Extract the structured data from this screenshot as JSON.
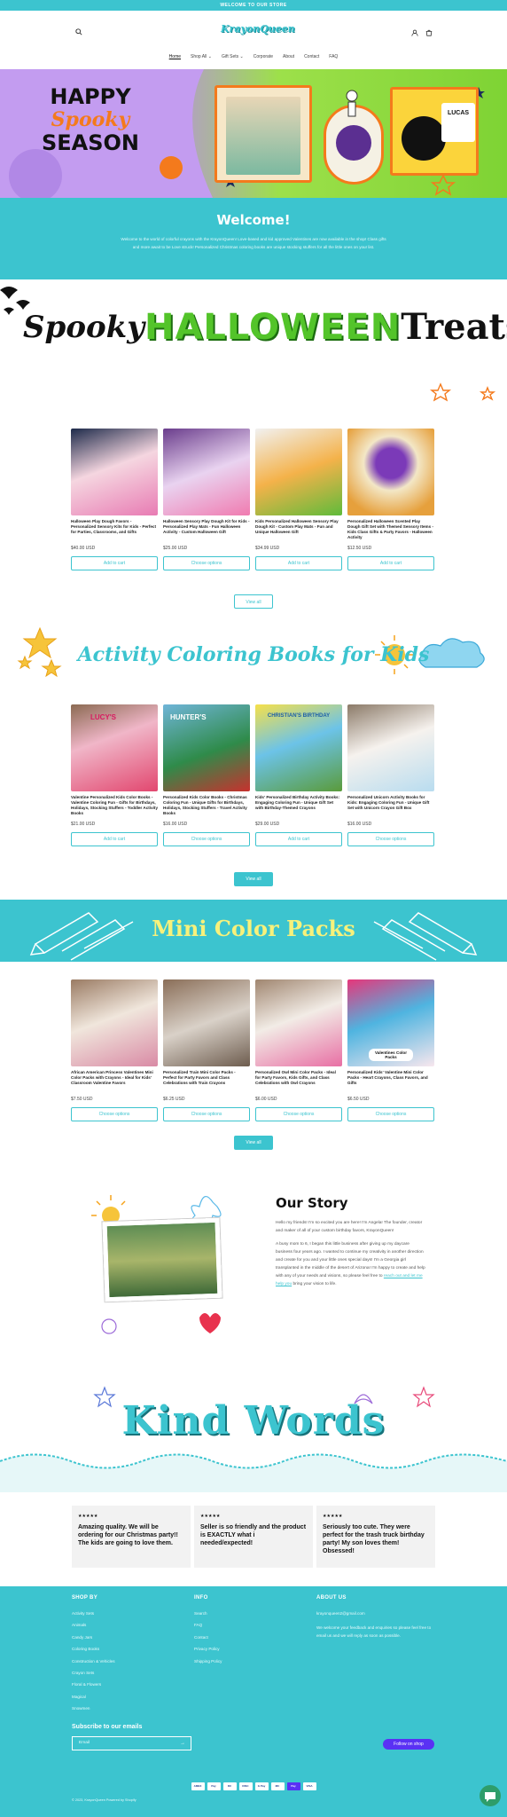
{
  "announcement": "WELCOME TO OUR STORE",
  "header": {
    "logo": "KrayonQueen",
    "nav": [
      "Home",
      "Shop All",
      "Gift Sets",
      "Corporate",
      "About",
      "Contact",
      "FAQ"
    ]
  },
  "hero": {
    "line1": "HAPPY",
    "line2": "Spooky",
    "line3": "SEASON",
    "card_label": "LUCAS"
  },
  "welcome": {
    "title": "Welcome!",
    "text": "Welcome to the world of colorful crayons with the KrayonQueen! Love-based and kid approved Valentines are now available in the shop! Class gifts and more await to be Love struck! Personalized Christmas coloring books are unique stocking stuffers for all the little ones on your list."
  },
  "spooky_banner": {
    "word1": "Spooky",
    "word2": "HALLOWEEN",
    "word3": "Treats"
  },
  "halloween_products": [
    {
      "title": "Halloween Play Dough Favors - Personalized Sensory Kits for Kids - Perfect for Parties, Classrooms, and Gifts",
      "price": "$40.00 USD",
      "button": "Add to cart"
    },
    {
      "title": "Halloween Sensory Play Dough Kit for Kids - Personalized Play Mats - Fun Halloween Activity - Custom Halloween Gift",
      "price": "$25.00 USD",
      "button": "Choose options"
    },
    {
      "title": "Kids Personalized Halloween Sensory Play Dough Kit - Custom Play Mats - Fun and Unique Halloween Gift",
      "price": "$34.99 USD",
      "button": "Add to cart"
    },
    {
      "title": "Personalized Halloween Scented Play Dough Gift Set with Themed Sensory Items - Kids Class Gifts & Party Favors - Halloween Activity",
      "price": "$12.50 USD",
      "button": "Add to cart"
    }
  ],
  "view_all": "View all",
  "activity_banner": "Activity Coloring Books for Kids",
  "activity_products": [
    {
      "title": "Valentine Personalized Kids Color Books - Valentine Coloring Fun - Gifts for Birthdays, Holidays, Stocking Stuffers - Toddler Activity Books",
      "price": "$21.00 USD",
      "button": "Add to cart",
      "cover": "LUCY'S"
    },
    {
      "title": "Personalized Kids Color Books - Christmas Coloring Fun - Unique Gifts for Birthdays, Holidays, Stocking Stuffers - Travel Activity Books",
      "price": "$16.00 USD",
      "button": "Choose options",
      "cover": "HUNTER'S"
    },
    {
      "title": "Kids' Personalized Birthday Activity Books: Engaging Coloring Fun - Unique Gift Set with Birthday-Themed Crayons",
      "price": "$29.00 USD",
      "button": "Add to cart",
      "cover": "CHRISTIAN'S BIRTHDAY"
    },
    {
      "title": "Personalized Unicorn Activity Books for Kids: Engaging Coloring Fun - Unique Gift Set with Unicorn Crayon Gift Box",
      "price": "$16.00 USD",
      "button": "Choose options",
      "cover": ""
    }
  ],
  "mini_banner": "Mini Color Packs",
  "mini_products": [
    {
      "title": "African American Princess Valentines Mini Color Packs with Crayons - Ideal for Kids' Classroom Valentine Favors",
      "price": "$7.50 USD",
      "button": "Choose options",
      "tag": ""
    },
    {
      "title": "Personalized Train Mini Color Packs - Perfect for Party Favors and Class Celebrations with Train Crayons",
      "price": "$6.25 USD",
      "button": "Choose options",
      "tag": ""
    },
    {
      "title": "Personalized Owl Mini Color Packs - Ideal for Party Favors, Kids Gifts, and Class Celebrations with Owl Crayons",
      "price": "$6.00 USD",
      "button": "Choose options",
      "tag": ""
    },
    {
      "title": "Personalized Kids' Valentine Mini Color Packs - Heart Crayons, Class Favors, and Gifts",
      "price": "$6.50 USD",
      "button": "Choose options",
      "tag": "Valentines Color Packs"
    }
  ],
  "story": {
    "title": "Our Story",
    "p1": "Hello my friends! I'm so excited you are here! I'm Angela! The founder, creator and maker of all of your custom birthday favors, KrayonQueen!",
    "p2_before": "A busy mom to 6, I began this little business after giving up my daycare business four years ago. I wanted to continue my creativity in another direction and create for you and your little ones special days! I'm a Georgia girl transplanted in the middle of the desert of Arizona! I'm happy to create and help with any of your needs and visions, so please feel free to",
    "p2_link": "reach out and let me help you",
    "p2_after": "bring your vision to life."
  },
  "kind_words": "Kind Words",
  "testimonials": [
    {
      "stars": "★★★★★",
      "quote": "Amazing quality. We will be ordering for our Christmas party!! The kids are going to love them."
    },
    {
      "stars": "★★★★★",
      "quote": "Seller is so friendly and the product is EXACTLY what i needed/expected!"
    },
    {
      "stars": "★★★★★",
      "quote": "Seriously too cute. They were perfect for the trash truck birthday party! My son loves them! Obsessed!"
    }
  ],
  "footer": {
    "shop_title": "SHOP BY",
    "shop_links": [
      "Activity Sets",
      "Animals",
      "Candy Jars",
      "Coloring Books",
      "Construction & Vehicles",
      "Crayon Sets",
      "Floral & Flowers",
      "Magical",
      "Snowmen"
    ],
    "info_title": "INFO",
    "info_links": [
      "Search",
      "FAQ",
      "Contact",
      "Privacy Policy",
      "Shipping Policy"
    ],
    "about_title": "ABOUT US",
    "about_email": "krayonqueen2@gmail.com",
    "about_text": "We welcome your feedback and enquiries so please feel free to email us and we will reply as soon as possible.",
    "subscribe_title": "Subscribe to our emails",
    "email_placeholder": "Email",
    "follow": "Follow on shop",
    "payments": [
      "AMEX",
      "Pay",
      "DC",
      "DISC",
      "G Pay",
      "MC",
      "Pay",
      "VISA"
    ],
    "copyright": "© 2023, KrayonQueen Powered by Shopify"
  },
  "colors": {
    "teal": "#3cc4cf",
    "orange": "#f47a1c",
    "green": "#53c42a",
    "purple": "#b98bea"
  }
}
